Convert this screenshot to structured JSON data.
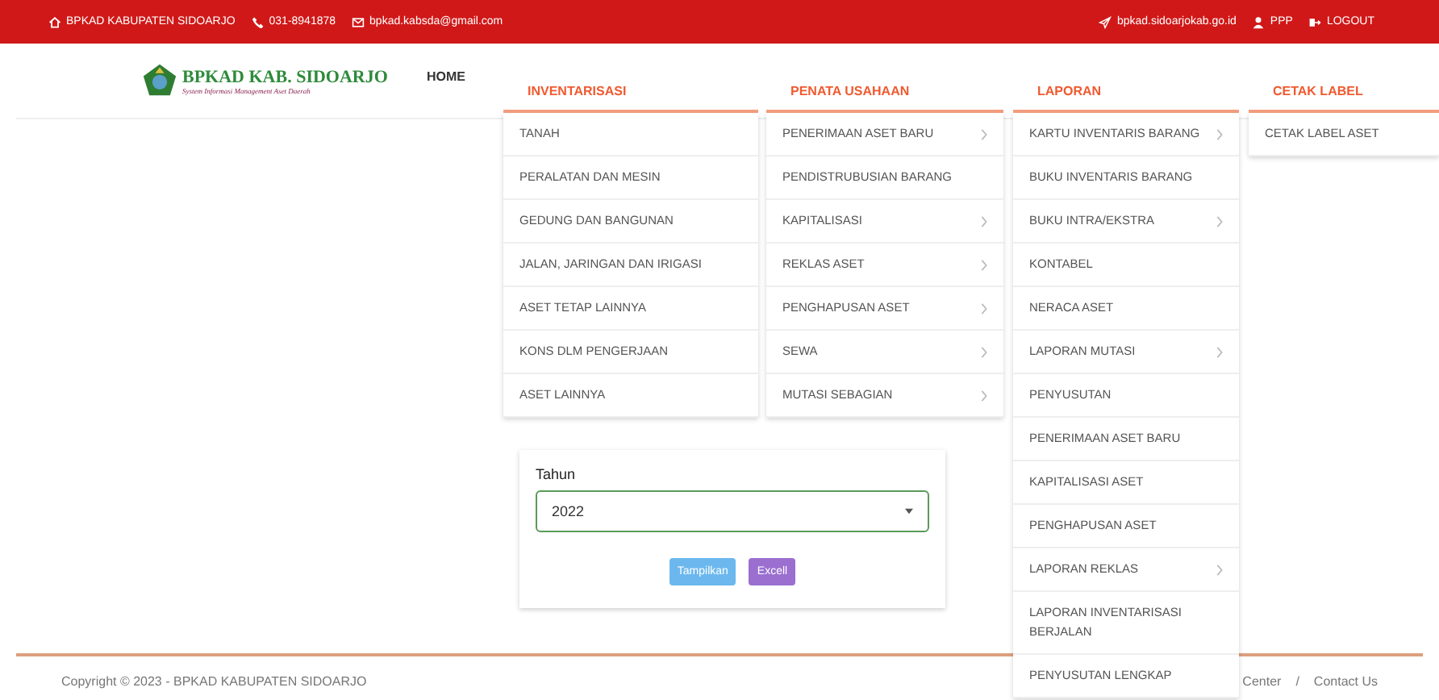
{
  "top_bar": {
    "left": [
      {
        "kind": "home",
        "text": "BPKAD KABUPATEN SIDOARJO"
      },
      {
        "kind": "phone",
        "text": "031-8941878"
      },
      {
        "kind": "mail",
        "text": "bpkad.kabsda@gmail.com"
      }
    ],
    "right": [
      {
        "kind": "send",
        "text": "bpkad.sidoarjokab.go.id"
      },
      {
        "kind": "user",
        "text": "PPP"
      },
      {
        "kind": "logout",
        "text": "LOGOUT"
      }
    ]
  },
  "logo": {
    "title": "BPKAD KAB. SIDOARJO",
    "subtitle": "System Informasi Management Aset Daerah"
  },
  "nav": {
    "home": "HOME",
    "menus": [
      {
        "title": "INVENTARISASI",
        "items": [
          {
            "label": "TANAH",
            "has_submenu": false
          },
          {
            "label": "PERALATAN DAN MESIN",
            "has_submenu": false
          },
          {
            "label": "GEDUNG DAN BANGUNAN",
            "has_submenu": false
          },
          {
            "label": "JALAN, JARINGAN DAN IRIGASI",
            "has_submenu": false
          },
          {
            "label": "ASET TETAP LAINNYA",
            "has_submenu": false
          },
          {
            "label": "KONS DLM PENGERJAAN",
            "has_submenu": false
          },
          {
            "label": "ASET LAINNYA",
            "has_submenu": false
          }
        ]
      },
      {
        "title": "PENATA USAHAAN",
        "items": [
          {
            "label": "PENERIMAAN ASET BARU",
            "has_submenu": true
          },
          {
            "label": "PENDISTRUBUSIAN BARANG",
            "has_submenu": false
          },
          {
            "label": "KAPITALISASI",
            "has_submenu": true
          },
          {
            "label": "REKLAS ASET",
            "has_submenu": true
          },
          {
            "label": "PENGHAPUSAN ASET",
            "has_submenu": true
          },
          {
            "label": "SEWA",
            "has_submenu": true
          },
          {
            "label": "MUTASI SEBAGIAN",
            "has_submenu": true
          }
        ]
      },
      {
        "title": "LAPORAN",
        "items": [
          {
            "label": "KARTU INVENTARIS BARANG",
            "has_submenu": true
          },
          {
            "label": "BUKU INVENTARIS BARANG",
            "has_submenu": false
          },
          {
            "label": "BUKU INTRA/EKSTRA",
            "has_submenu": true
          },
          {
            "label": "KONTABEL",
            "has_submenu": false
          },
          {
            "label": "NERACA ASET",
            "has_submenu": false
          },
          {
            "label": "LAPORAN MUTASI",
            "has_submenu": true
          },
          {
            "label": "PENYUSUTAN",
            "has_submenu": false
          },
          {
            "label": "PENERIMAAN ASET BARU",
            "has_submenu": false
          },
          {
            "label": "KAPITALISASI ASET",
            "has_submenu": false
          },
          {
            "label": "PENGHAPUSAN ASET",
            "has_submenu": false
          },
          {
            "label": "LAPORAN REKLAS",
            "has_submenu": true
          },
          {
            "label": "LAPORAN INVENTARISASI BERJALAN",
            "has_submenu": false
          },
          {
            "label": "PENYUSUTAN LENGKAP",
            "has_submenu": false
          }
        ]
      },
      {
        "title": "CETAK LABEL",
        "items": [
          {
            "label": "CETAK LABEL ASET",
            "has_submenu": false
          }
        ]
      }
    ]
  },
  "form": {
    "label": "Tahun",
    "select_value": "2022",
    "buttons": [
      {
        "kind": "show",
        "label": "Tampilkan"
      },
      {
        "kind": "excel",
        "label": "Excell"
      }
    ]
  },
  "footer": {
    "copyright": "Copyright © 2023 - BPKAD KABUPATEN SIDOARJO",
    "links": [
      "Center",
      "Contact Us"
    ],
    "separator": "/"
  }
}
